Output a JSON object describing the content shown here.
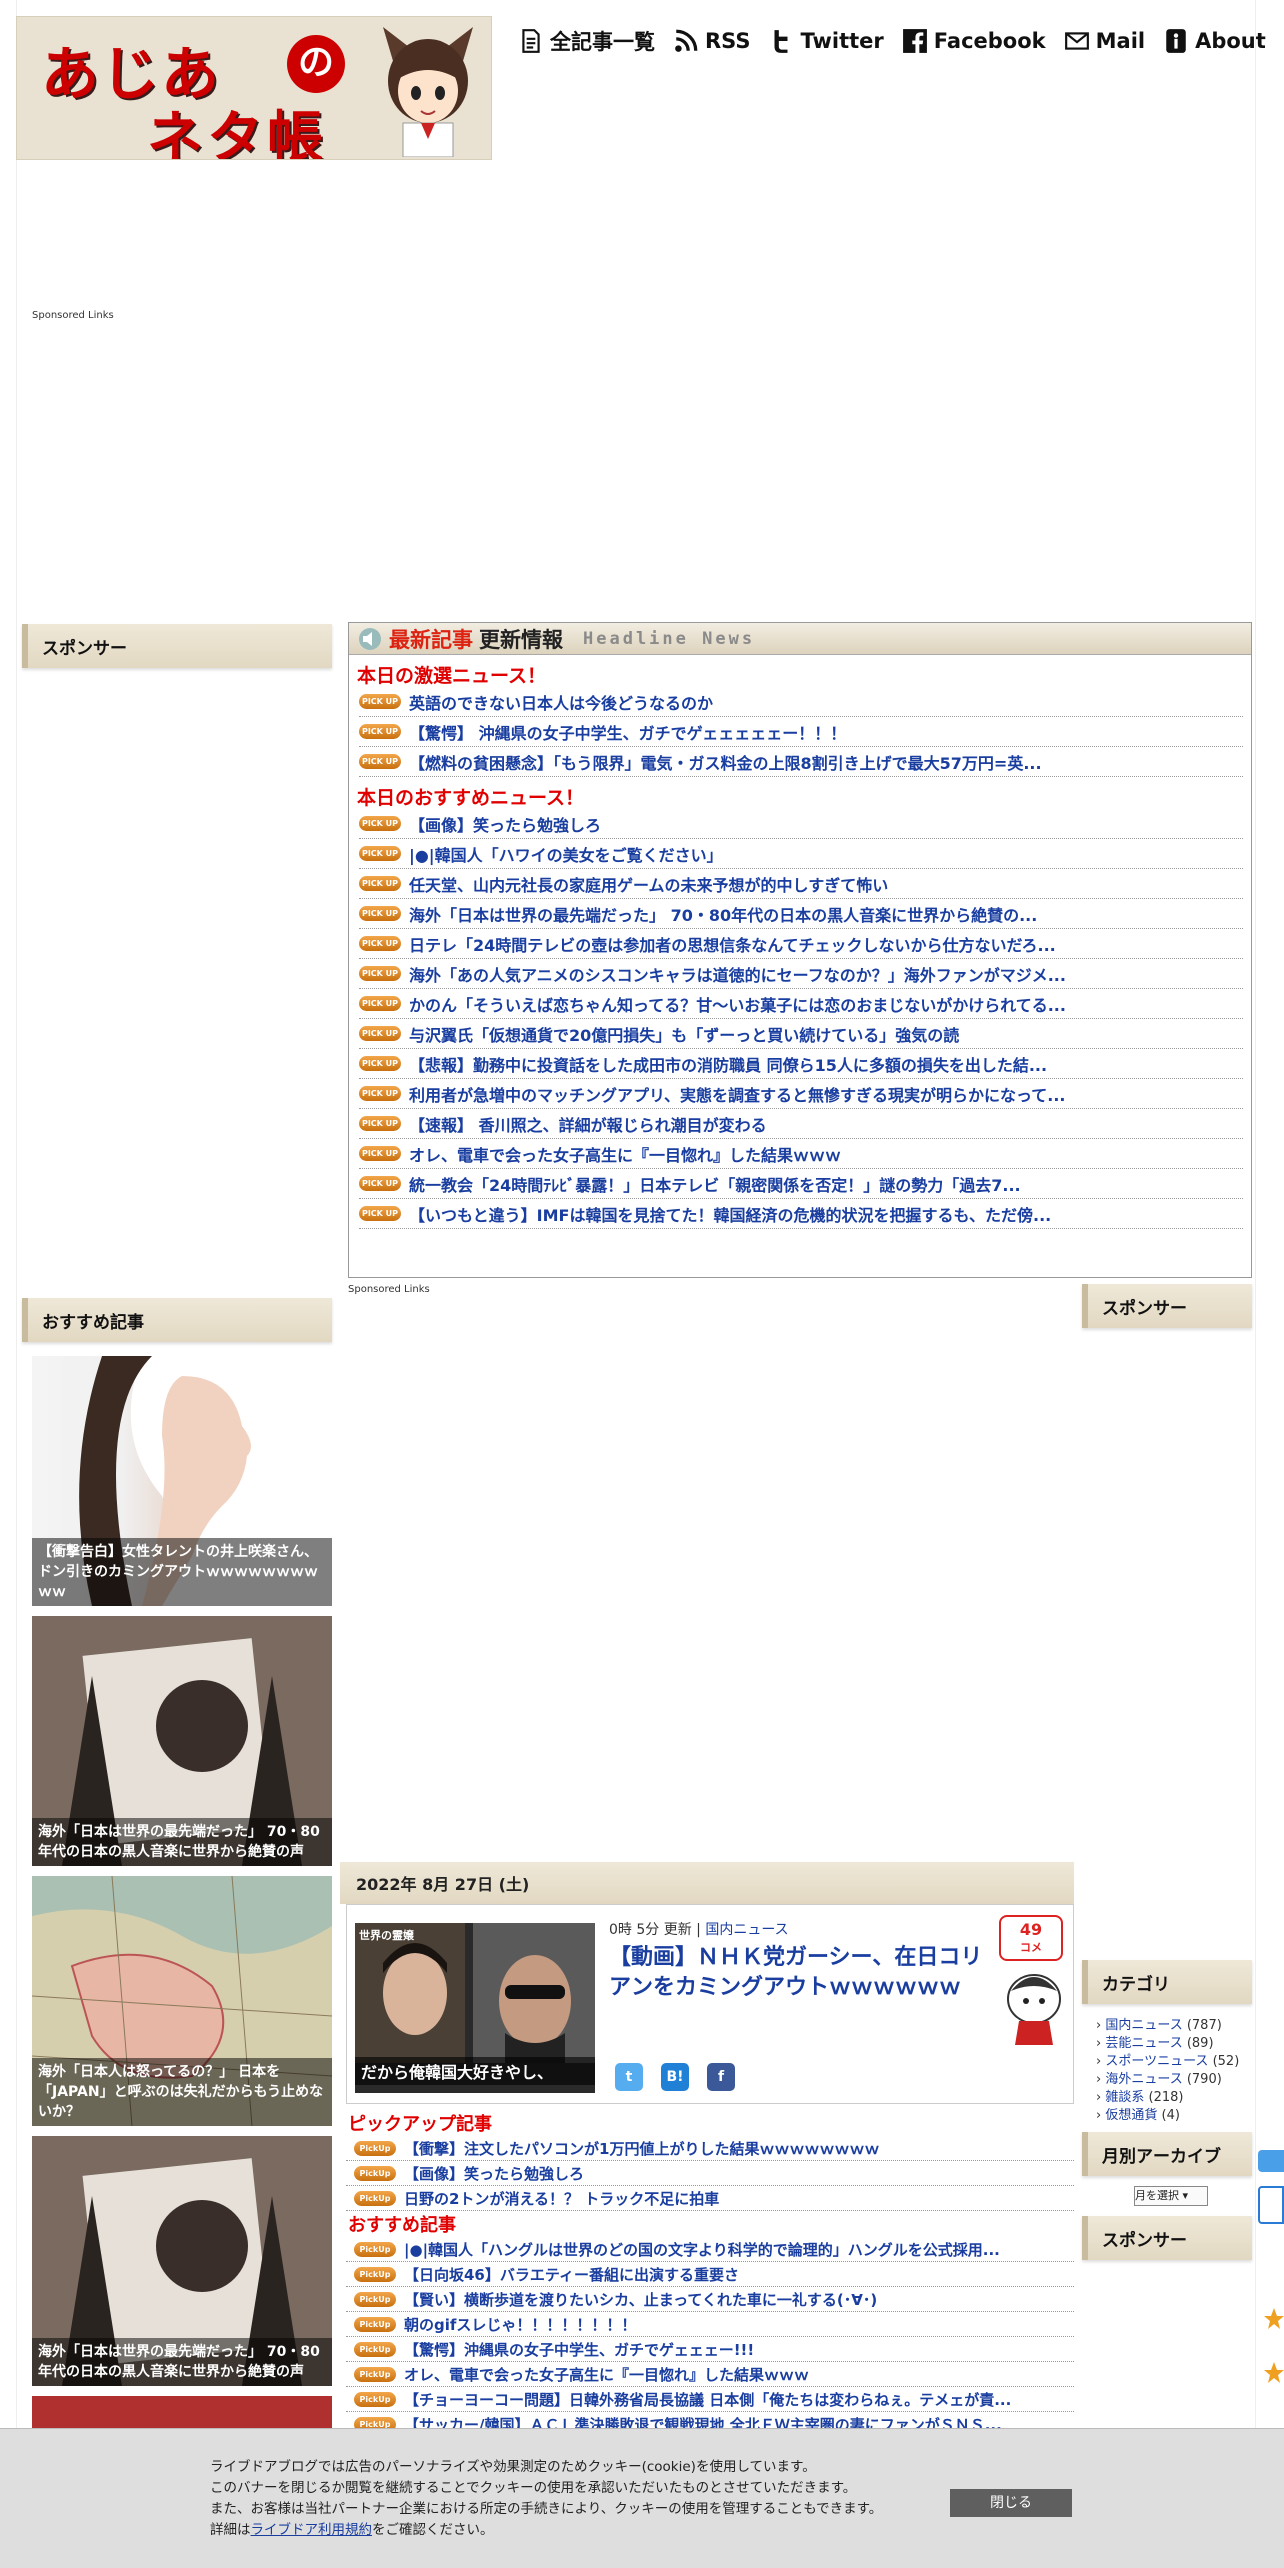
{
  "header": {
    "logo_line1": "あじあ",
    "logo_no": "の",
    "logo_line2": "ネタ帳",
    "nav": [
      {
        "label": "全記事一覧",
        "icon": "document-icon"
      },
      {
        "label": "RSS",
        "icon": "rss-icon"
      },
      {
        "label": "Twitter",
        "icon": "twitter-icon"
      },
      {
        "label": "Facebook",
        "icon": "facebook-icon"
      },
      {
        "label": "Mail",
        "icon": "mail-icon"
      },
      {
        "label": "About",
        "icon": "info-icon"
      }
    ]
  },
  "sponsored_links": "Sponsored Links",
  "left_sidebar": {
    "sponsor_title": "スポンサー",
    "recommend_title": "おすすめ記事",
    "recommend": [
      "【衝撃告白】女性タレントの井上咲楽さん、ドン引きのカミングアウトｗｗｗｗｗｗｗｗｗｗ",
      "海外「日本は世界の最先端だった」 70・80年代の日本の黒人音楽に世界から絶賛の声",
      "海外「日本人は怒ってるの？」 日本を「JAPAN」と呼ぶのは失礼だからもう止めないか？",
      "海外「日本は世界の最先端だった」 70・80年代の日本の黒人音楽に世界から絶賛の声"
    ]
  },
  "headline": {
    "title_red": "最新記事",
    "title_black": "更新情報",
    "title_en": "Headline News",
    "section1": "本日の激選ニュース！",
    "items1": [
      "英語のできない日本人は今後どうなるのか",
      "【驚愕】 沖縄県の女子中学生、ガチでゲェェェェェー！！！",
      "【燃料の貧困懸念】「もう限界」電気・ガス料金の上限8割引き上げで最大57万円=英..."
    ],
    "section2": "本日のおすすめニュース！",
    "items2": [
      "【画像】笑ったら勉強しろ",
      "|●|韓国人「ハワイの美女をご覧ください」",
      "任天堂、山内元社長の家庭用ゲームの未来予想が的中しすぎて怖い",
      "海外「日本は世界の最先端だった」 70・80年代の日本の黒人音楽に世界から絶賛の...",
      "日テレ「24時間テレビの壺は参加者の思想信条なんてチェックしないから仕方ないだろ...",
      "海外「あの人気アニメのシスコンキャラは道徳的にセーフなのか？」海外ファンがマジメ...",
      "かのん「そういえば恋ちゃん知ってる？甘～いお菓子には恋のおまじないがかけられてる...",
      "与沢翼氏「仮想通貨で20億円損失」も「ずーっと買い続けている」強気の読",
      "【悲報】勤務中に投資話をした成田市の消防職員 同僚ら15人に多額の損失を出した結...",
      "利用者が急増中のマッチングアプリ、実態を調査すると無慘すぎる現実が明らかになって...",
      "【速報】 香川照之、詳細が報じられ潮目が変わる",
      "オレ、電車で会った女子高生に『一目惚れ』した結果ｗｗｗ",
      "統一教会「24時間ﾃﾚﾋﾞ暴露！」日本テレビ「親密関係を否定！」謎の勢力「過去7...",
      "【いつもと違う】IMFは韓国を見捨てた！韓国経済の危機的状況を把握するも、ただ傍..."
    ],
    "pickup_badge": "PICK UP"
  },
  "article": {
    "date": "2022年 8月 27日 (土)",
    "time": "0時 5分 更新",
    "category": "国内ニュース",
    "title": "【動画】ＮＨＫ党ガーシー、在日コリアンをカミングアウトｗｗｗｗｗｗ",
    "comments": "49",
    "comments_label": "コメ",
    "thumb_caption": "だから俺韓国大好きやし、",
    "thumb_label": "世界の霊嬢"
  },
  "pickup": {
    "title1": "ピックアップ記事",
    "items1": [
      "【衝撃】注文したパソコンが1万円値上がりした結果ｗｗｗｗｗｗｗｗ",
      "【画像】笑ったら勉強しろ",
      "日野の2トンが消える！？ トラック不足に拍車"
    ],
    "title2": "おすすめ記事",
    "items2": [
      "|●|韓国人「ハングルは世界のどの国の文字より科学的で論理的」ハングルを公式採用...",
      "【日向坂46】バラエティー番組に出演する重要さ",
      "【賢い】横断歩道を渡りたいシカ、止まってくれた車に一礼する(･∀･)",
      "朝のgifスレじゃ！！！！！！！！",
      "【驚愕】沖縄県の女子中学生、ガチでゲェェェー!!!",
      "オレ、電車で会った女子高生に『一目惚れ』した結果ｗｗｗ",
      "【チョーヨーコー問題】日韓外務省局長協議 日本側「俺たちは変わらねぇ。テメェが責...",
      "【サッカー/韓国】ＡＣＬ準決勝敗退で観戦現地 全北ＦＷ主宰圏の妻にファンがＳＮＳ..."
    ],
    "badge": "PickUp"
  },
  "right_sidebar": {
    "sponsor_title": "スポンサー",
    "category_title": "カテゴリ",
    "categories": [
      {
        "name": "国内ニュース",
        "count": "(787)"
      },
      {
        "name": "芸能ニュース",
        "count": "(89)"
      },
      {
        "name": "スポーツニュース",
        "count": "(52)"
      },
      {
        "name": "海外ニュース",
        "count": "(790)"
      },
      {
        "name": "雑談系",
        "count": "(218)"
      },
      {
        "name": "仮想通貨",
        "count": "(4)"
      }
    ],
    "archive_title": "月別アーカイブ",
    "archive_select": "月を選択",
    "sponsor_title2": "スポンサー"
  },
  "cookie": {
    "line1": "ライブドアブログでは広告のパーソナライズや効果測定のためクッキー(cookie)を使用しています。",
    "line2": "このバナーを閉じるか閲覧を継続することでクッキーの使用を承認いただいたものとさせていただきます。",
    "line3": "また、お客様は当社パートナー企業における所定の手続きにより、クッキーの使用を管理することもできます。",
    "line4_prefix": "詳細は",
    "line4_link": "ライブドア利用規約",
    "line4_suffix": "をご確認ください。",
    "close": "閉じる"
  }
}
